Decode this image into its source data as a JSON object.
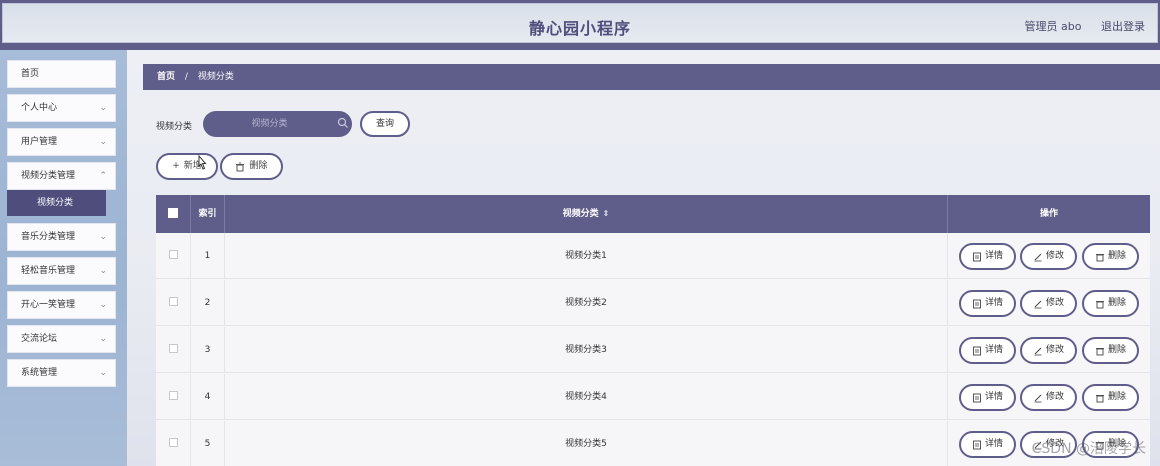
{
  "header": {
    "title": "静心园小程序",
    "user": "管理员 abo",
    "logout": "退出登录"
  },
  "sidebar": {
    "items": [
      {
        "label": "首页",
        "chevron": false
      },
      {
        "label": "个人中心",
        "chevron": true
      },
      {
        "label": "用户管理",
        "chevron": true
      },
      {
        "label": "视频分类管理",
        "chevron": true
      },
      {
        "label": "音乐分类管理",
        "chevron": true
      },
      {
        "label": "轻松音乐管理",
        "chevron": true
      },
      {
        "label": "开心一笑管理",
        "chevron": true
      },
      {
        "label": "交流论坛",
        "chevron": true
      },
      {
        "label": "系统管理",
        "chevron": true
      }
    ],
    "submenu": {
      "label": "视频分类"
    }
  },
  "breadcrumb": {
    "home": "首页",
    "separator": "/",
    "current": "视频分类"
  },
  "search": {
    "label": "视频分类",
    "placeholder": "视频分类",
    "button": "查询"
  },
  "actions": {
    "add": "新增",
    "delete": "删除"
  },
  "table": {
    "columns": {
      "index": "索引",
      "name": "视频分类",
      "ops": "操作"
    },
    "rows": [
      {
        "index": "1",
        "name": "视频分类1"
      },
      {
        "index": "2",
        "name": "视频分类2"
      },
      {
        "index": "3",
        "name": "视频分类3"
      },
      {
        "index": "4",
        "name": "视频分类4"
      },
      {
        "index": "5",
        "name": "视频分类5"
      }
    ],
    "row_actions": {
      "detail": "详情",
      "edit": "修改",
      "delete": "删除"
    }
  },
  "watermark": "CSDN @涪陵学长",
  "colors": {
    "primary": "#5f5d8a",
    "sidebar": "#a6bcd8",
    "active_submenu": "#4f4d7c"
  }
}
